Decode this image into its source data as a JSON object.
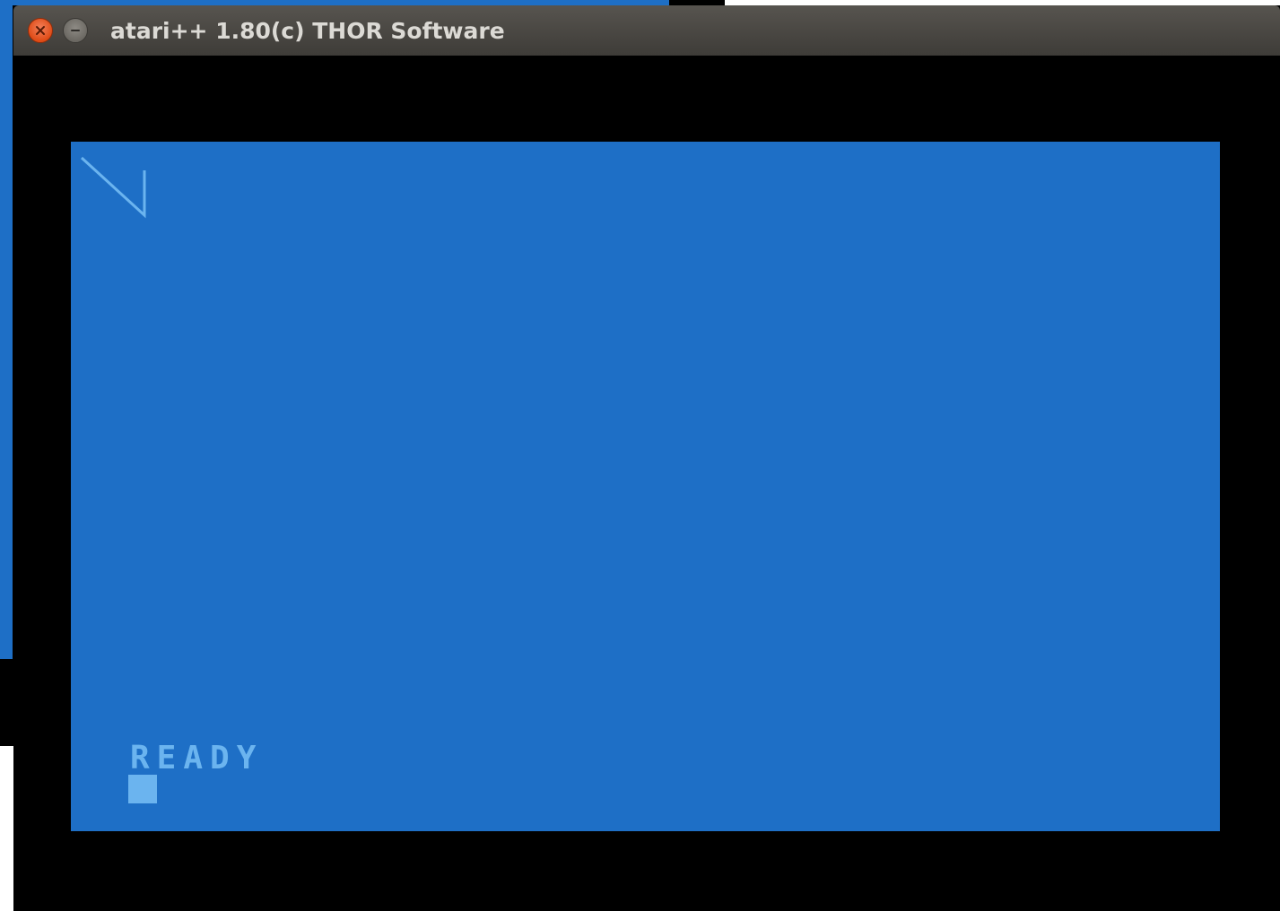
{
  "window": {
    "title": "atari++ 1.80(c) THOR Software",
    "close_icon": "close-icon",
    "minimize_icon": "minimize-icon"
  },
  "screen": {
    "background_color": "#1e6fc6",
    "foreground_color": "#6bb4ef",
    "status_text": "READY"
  }
}
